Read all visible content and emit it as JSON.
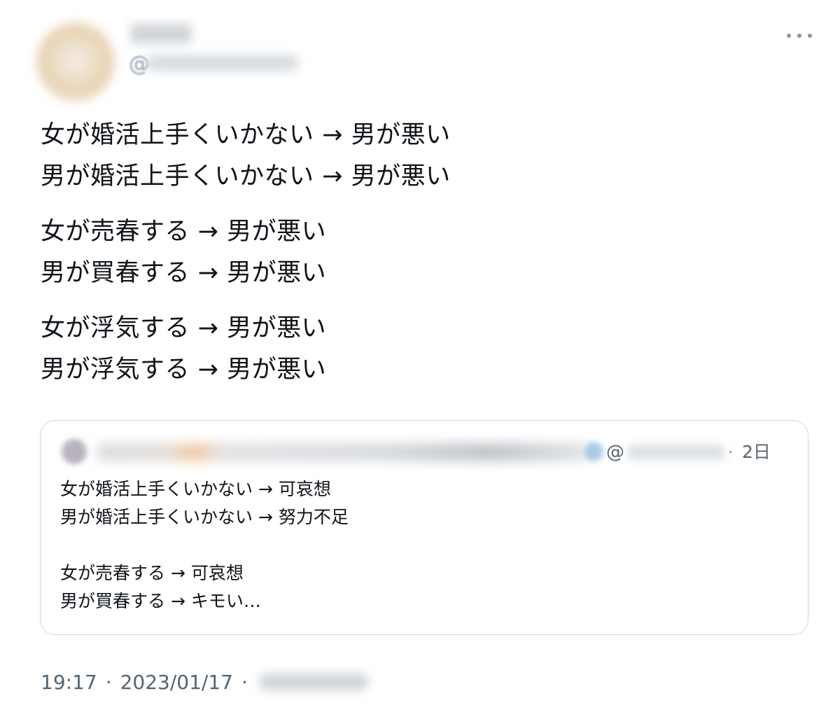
{
  "tweet": {
    "handle_prefix": "@",
    "lines": [
      "女が婚活上手くいかない → 男が悪い",
      "男が婚活上手くいかない → 男が悪い",
      "女が売春する → 男が悪い",
      "男が買春する → 男が悪い",
      "女が浮気する → 男が悪い",
      "男が浮気する → 男が悪い"
    ],
    "more_icon": "more-horizontal-icon"
  },
  "quote": {
    "handle_prefix": "@",
    "separator": "·",
    "time": "2日",
    "lines": [
      "女が婚活上手くいかない → 可哀想",
      "男が婚活上手くいかない → 努力不足",
      "",
      "女が売春する → 可哀想",
      "男が買春する → キモい…"
    ]
  },
  "footer": {
    "time": "19:17",
    "separator": "·",
    "date": "2023/01/17",
    "separator2": "·"
  },
  "colors": {
    "text": "#0f1419",
    "secondary": "#536471",
    "border": "#cfd9de"
  }
}
